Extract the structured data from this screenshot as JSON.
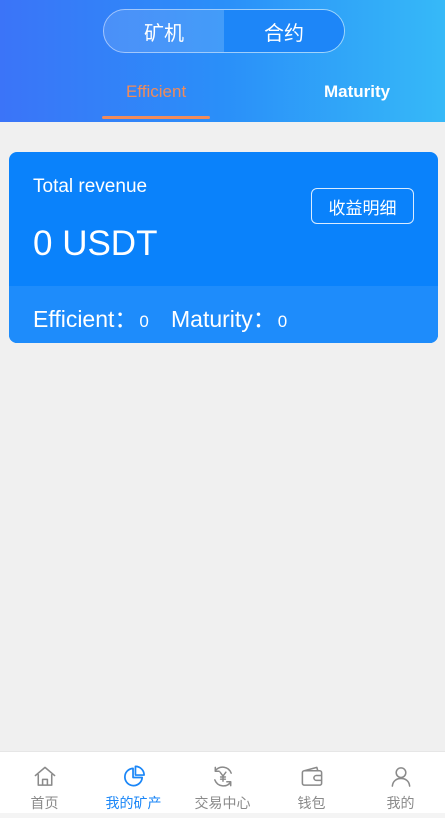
{
  "segment": {
    "items": [
      {
        "label": "矿机"
      },
      {
        "label": "合约"
      }
    ],
    "selected_index": 1
  },
  "subtabs": {
    "items": [
      {
        "label": "Efficient"
      },
      {
        "label": "Maturity"
      }
    ],
    "active_index": 0
  },
  "revenue_card": {
    "label": "Total revenue",
    "value": "0 USDT",
    "detail_button": "收益明细",
    "efficient_label": "Efficient：",
    "efficient_value": "0",
    "maturity_label": "Maturity：",
    "maturity_value": "0"
  },
  "tabbar": {
    "items": [
      {
        "label": "首页",
        "icon": "home-icon"
      },
      {
        "label": "我的矿产",
        "icon": "pie-chart-icon"
      },
      {
        "label": "交易中心",
        "icon": "yuan-exchange-icon"
      },
      {
        "label": "钱包",
        "icon": "wallet-icon"
      },
      {
        "label": "我的",
        "icon": "user-icon"
      }
    ],
    "active_index": 1
  },
  "colors": {
    "primary": "#0a82fb",
    "accent_orange": "#f08b5a",
    "active_tab": "#1a86f7",
    "inactive_tab": "#8a8a8a",
    "background": "#f0f0f0"
  }
}
